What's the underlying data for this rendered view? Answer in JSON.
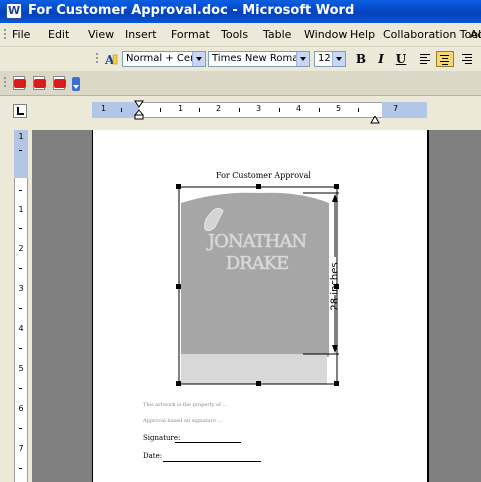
{
  "title_bar": {
    "title": "For Customer Approval.doc - Microsoft Word",
    "icon": "word-doc-icon"
  },
  "menu": {
    "items": [
      "File",
      "Edit",
      "View",
      "Insert",
      "Format",
      "Tools",
      "Table",
      "Window",
      "Help",
      "Collaboration Tools",
      "Ac"
    ]
  },
  "formatting": {
    "style": "Normal + Cente",
    "font": "Times New Roman",
    "size": "12",
    "bold": "B",
    "italic": "I",
    "underline": "U"
  },
  "pdf_toolbar": {
    "icons": [
      "pdf-convert-icon",
      "pdf-email-icon",
      "pdf-review-icon"
    ]
  },
  "ruler": {
    "h_numbers": [
      "1",
      "1",
      "2",
      "3",
      "4",
      "5",
      "7"
    ],
    "v_numbers": [
      "1",
      "1",
      "2",
      "3",
      "4",
      "5",
      "6",
      "7"
    ]
  },
  "document": {
    "heading": "For Customer Approval",
    "stone_name_line1": "JONATHAN",
    "stone_name_line2": "DRAKE",
    "dimension": "28 inches",
    "notice_line1": "This artwork is the property of ...",
    "notice_line2": "Approval based on signature ...",
    "signature_label": "Signature:",
    "date_label": "Date:"
  },
  "colors": {
    "titlebar": "#0a55d8",
    "stone": "#a6a6a6",
    "base": "#d8d8d8"
  }
}
